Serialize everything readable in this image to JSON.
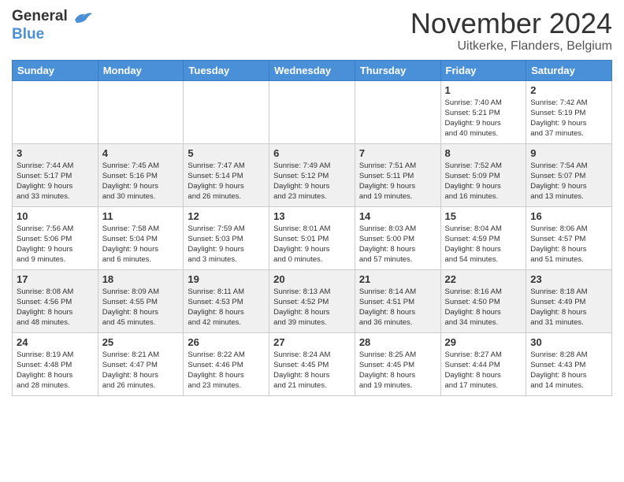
{
  "header": {
    "logo": {
      "general": "General",
      "blue": "Blue"
    },
    "title": "November 2024",
    "location": "Uitkerke, Flanders, Belgium"
  },
  "days_of_week": [
    "Sunday",
    "Monday",
    "Tuesday",
    "Wednesday",
    "Thursday",
    "Friday",
    "Saturday"
  ],
  "weeks": [
    [
      {
        "day": "",
        "info": ""
      },
      {
        "day": "",
        "info": ""
      },
      {
        "day": "",
        "info": ""
      },
      {
        "day": "",
        "info": ""
      },
      {
        "day": "",
        "info": ""
      },
      {
        "day": "1",
        "info": "Sunrise: 7:40 AM\nSunset: 5:21 PM\nDaylight: 9 hours\nand 40 minutes."
      },
      {
        "day": "2",
        "info": "Sunrise: 7:42 AM\nSunset: 5:19 PM\nDaylight: 9 hours\nand 37 minutes."
      }
    ],
    [
      {
        "day": "3",
        "info": "Sunrise: 7:44 AM\nSunset: 5:17 PM\nDaylight: 9 hours\nand 33 minutes."
      },
      {
        "day": "4",
        "info": "Sunrise: 7:45 AM\nSunset: 5:16 PM\nDaylight: 9 hours\nand 30 minutes."
      },
      {
        "day": "5",
        "info": "Sunrise: 7:47 AM\nSunset: 5:14 PM\nDaylight: 9 hours\nand 26 minutes."
      },
      {
        "day": "6",
        "info": "Sunrise: 7:49 AM\nSunset: 5:12 PM\nDaylight: 9 hours\nand 23 minutes."
      },
      {
        "day": "7",
        "info": "Sunrise: 7:51 AM\nSunset: 5:11 PM\nDaylight: 9 hours\nand 19 minutes."
      },
      {
        "day": "8",
        "info": "Sunrise: 7:52 AM\nSunset: 5:09 PM\nDaylight: 9 hours\nand 16 minutes."
      },
      {
        "day": "9",
        "info": "Sunrise: 7:54 AM\nSunset: 5:07 PM\nDaylight: 9 hours\nand 13 minutes."
      }
    ],
    [
      {
        "day": "10",
        "info": "Sunrise: 7:56 AM\nSunset: 5:06 PM\nDaylight: 9 hours\nand 9 minutes."
      },
      {
        "day": "11",
        "info": "Sunrise: 7:58 AM\nSunset: 5:04 PM\nDaylight: 9 hours\nand 6 minutes."
      },
      {
        "day": "12",
        "info": "Sunrise: 7:59 AM\nSunset: 5:03 PM\nDaylight: 9 hours\nand 3 minutes."
      },
      {
        "day": "13",
        "info": "Sunrise: 8:01 AM\nSunset: 5:01 PM\nDaylight: 9 hours\nand 0 minutes."
      },
      {
        "day": "14",
        "info": "Sunrise: 8:03 AM\nSunset: 5:00 PM\nDaylight: 8 hours\nand 57 minutes."
      },
      {
        "day": "15",
        "info": "Sunrise: 8:04 AM\nSunset: 4:59 PM\nDaylight: 8 hours\nand 54 minutes."
      },
      {
        "day": "16",
        "info": "Sunrise: 8:06 AM\nSunset: 4:57 PM\nDaylight: 8 hours\nand 51 minutes."
      }
    ],
    [
      {
        "day": "17",
        "info": "Sunrise: 8:08 AM\nSunset: 4:56 PM\nDaylight: 8 hours\nand 48 minutes."
      },
      {
        "day": "18",
        "info": "Sunrise: 8:09 AM\nSunset: 4:55 PM\nDaylight: 8 hours\nand 45 minutes."
      },
      {
        "day": "19",
        "info": "Sunrise: 8:11 AM\nSunset: 4:53 PM\nDaylight: 8 hours\nand 42 minutes."
      },
      {
        "day": "20",
        "info": "Sunrise: 8:13 AM\nSunset: 4:52 PM\nDaylight: 8 hours\nand 39 minutes."
      },
      {
        "day": "21",
        "info": "Sunrise: 8:14 AM\nSunset: 4:51 PM\nDaylight: 8 hours\nand 36 minutes."
      },
      {
        "day": "22",
        "info": "Sunrise: 8:16 AM\nSunset: 4:50 PM\nDaylight: 8 hours\nand 34 minutes."
      },
      {
        "day": "23",
        "info": "Sunrise: 8:18 AM\nSunset: 4:49 PM\nDaylight: 8 hours\nand 31 minutes."
      }
    ],
    [
      {
        "day": "24",
        "info": "Sunrise: 8:19 AM\nSunset: 4:48 PM\nDaylight: 8 hours\nand 28 minutes."
      },
      {
        "day": "25",
        "info": "Sunrise: 8:21 AM\nSunset: 4:47 PM\nDaylight: 8 hours\nand 26 minutes."
      },
      {
        "day": "26",
        "info": "Sunrise: 8:22 AM\nSunset: 4:46 PM\nDaylight: 8 hours\nand 23 minutes."
      },
      {
        "day": "27",
        "info": "Sunrise: 8:24 AM\nSunset: 4:45 PM\nDaylight: 8 hours\nand 21 minutes."
      },
      {
        "day": "28",
        "info": "Sunrise: 8:25 AM\nSunset: 4:45 PM\nDaylight: 8 hours\nand 19 minutes."
      },
      {
        "day": "29",
        "info": "Sunrise: 8:27 AM\nSunset: 4:44 PM\nDaylight: 8 hours\nand 17 minutes."
      },
      {
        "day": "30",
        "info": "Sunrise: 8:28 AM\nSunset: 4:43 PM\nDaylight: 8 hours\nand 14 minutes."
      }
    ]
  ]
}
